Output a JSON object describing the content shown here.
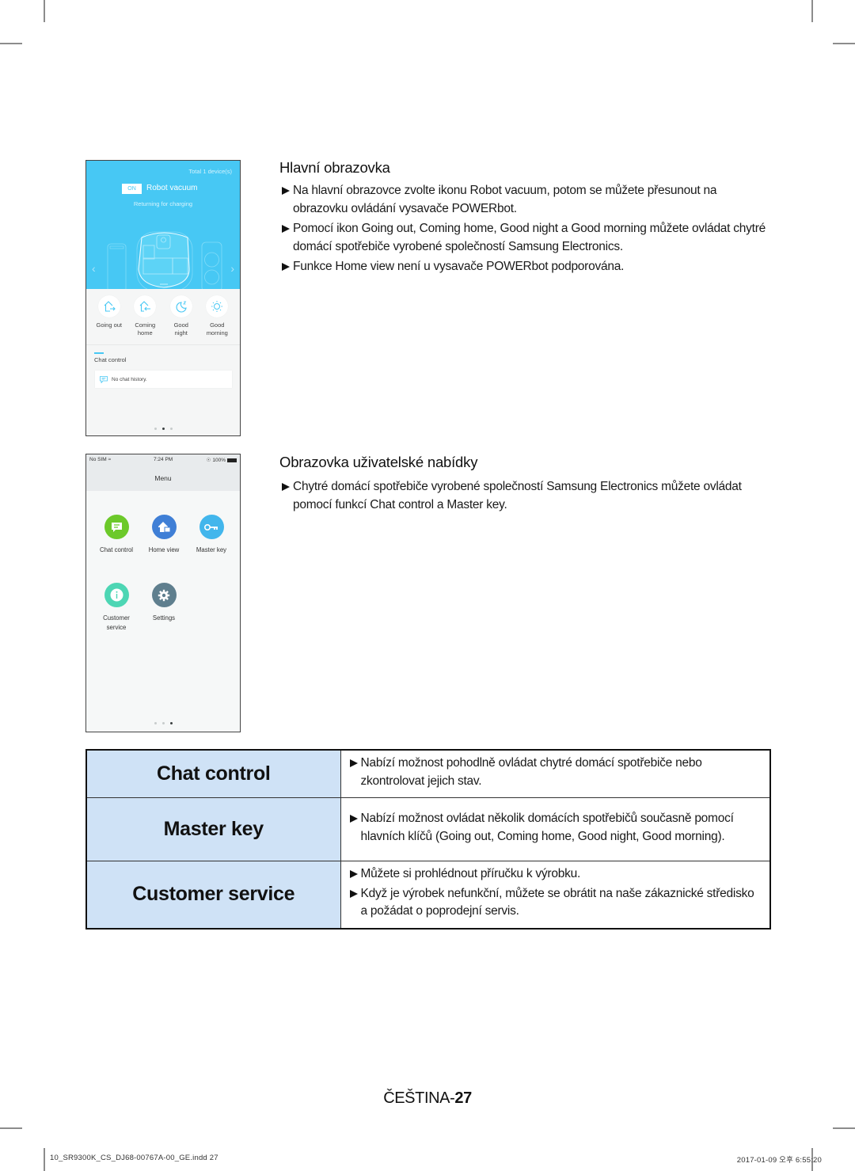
{
  "main_screen": {
    "title": "Hlavní obrazovka",
    "bullets": [
      "Na hlavní obrazovce zvolte ikonu Robot vacuum, potom se můžete přesunout na obrazovku ovládání vysavače POWERbot.",
      "Pomocí ikon Going out, Coming home, Good night a Good morning můžete ovládat chytré domácí spotřebiče vyrobené společností Samsung Electronics.",
      "Funkce Home view není u vysavače POWERbot podporována."
    ],
    "phone": {
      "total_devices": "Total 1 device(s)",
      "power_badge": "ON",
      "device_name": "Robot vacuum",
      "device_status": "Returning for charging",
      "modes": [
        {
          "label_line1": "Going out",
          "label_line2": "",
          "icon": "going-out-icon"
        },
        {
          "label_line1": "Coming",
          "label_line2": "home",
          "icon": "coming-home-icon"
        },
        {
          "label_line1": "Good",
          "label_line2": "night",
          "icon": "good-night-icon"
        },
        {
          "label_line1": "Good",
          "label_line2": "morning",
          "icon": "good-morning-icon"
        }
      ],
      "chat_section_title": "Chat control",
      "chat_empty": "No chat history.",
      "page_indicator": {
        "count": 3,
        "active": 2
      }
    }
  },
  "menu_screen": {
    "title": "Obrazovka uživatelské nabídky",
    "bullets": [
      "Chytré domácí spotřebiče vyrobené společností Samsung Electronics můžete ovládat pomocí funkcí Chat control a Master key."
    ],
    "phone": {
      "status_carrier": "No SIM",
      "status_time": "7:24 PM",
      "status_battery": "100%",
      "header": "Menu",
      "items": [
        {
          "label_line1": "Chat control",
          "label_line2": "",
          "icon": "chat-icon",
          "color": "#6cc92a"
        },
        {
          "label_line1": "Home view",
          "label_line2": "",
          "icon": "home-view-icon",
          "color": "#3f7fd6"
        },
        {
          "label_line1": "Master key",
          "label_line2": "",
          "icon": "key-icon",
          "color": "#42b6ec"
        },
        {
          "label_line1": "Customer",
          "label_line2": "service",
          "icon": "info-icon",
          "color": "#4dd6b4"
        },
        {
          "label_line1": "Settings",
          "label_line2": "",
          "icon": "gear-icon",
          "color": "#5f7f8e"
        }
      ],
      "page_indicator": {
        "count": 3,
        "active": 3
      }
    }
  },
  "feature_table": {
    "rows": [
      {
        "name": "Chat control",
        "bullets": [
          "Nabízí možnost pohodlně ovládat chytré domácí spotřebiče nebo zkontrolovat jejich stav."
        ]
      },
      {
        "name": "Master key",
        "bullets": [
          "Nabízí možnost ovládat několik domácích spotřebičů současně pomocí hlavních klíčů (Going out, Coming home, Good night, Good morning)."
        ]
      },
      {
        "name": "Customer service",
        "bullets": [
          "Můžete si prohlédnout příručku k výrobku.",
          "Když je výrobek nefunkční, můžete se obrátit na naše zákaznické středisko a požádat o poprodejní servis."
        ]
      }
    ]
  },
  "footer": {
    "language": "ČEŠTINA-",
    "page_number": "27",
    "slug_file": "10_SR9300K_CS_DJ68-00767A-00_GE.indd   27",
    "slug_date": "2017-01-09   오후 6:55:20"
  },
  "colors": {
    "app_blue": "#47c8f4",
    "table_header_bg": "#cfe2f6"
  }
}
